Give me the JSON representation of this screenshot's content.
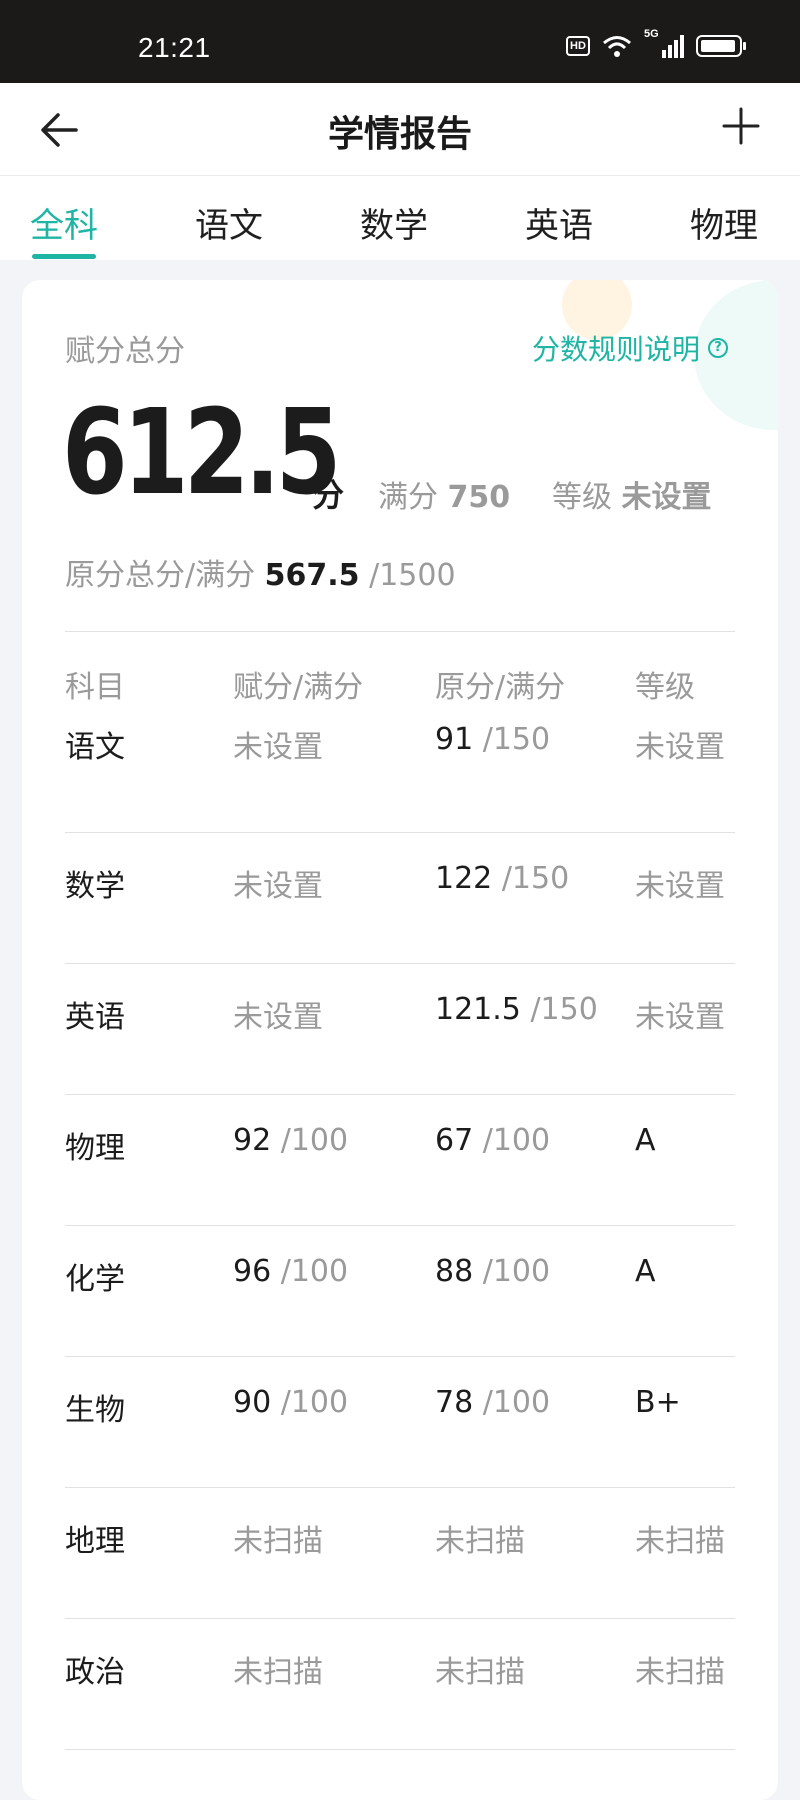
{
  "status_bar": {
    "time": "21:21",
    "hd": "HD",
    "network": "5G"
  },
  "header": {
    "title": "学情报告"
  },
  "tabs": [
    {
      "label": "全科",
      "active": true
    },
    {
      "label": "语文",
      "active": false
    },
    {
      "label": "数学",
      "active": false
    },
    {
      "label": "英语",
      "active": false
    },
    {
      "label": "物理",
      "active": false
    }
  ],
  "summary": {
    "total_label": "赋分总分",
    "rules_link": "分数规则说明",
    "score": "612.5",
    "score_unit": "分",
    "full_label": "满分",
    "full_value": "750",
    "grade_label": "等级",
    "grade_value": "未设置",
    "raw_label": "原分总分/满分",
    "raw_score": "567.5",
    "raw_full": "/1500"
  },
  "table": {
    "headers": [
      "科目",
      "赋分/满分",
      "原分/满分",
      "等级"
    ],
    "rows": [
      {
        "subject": "语文",
        "scaled": "未设置",
        "scaled_full": "",
        "raw": "91",
        "raw_full": "/150",
        "grade": "未设置"
      },
      {
        "subject": "数学",
        "scaled": "未设置",
        "scaled_full": "",
        "raw": "122",
        "raw_full": "/150",
        "grade": "未设置"
      },
      {
        "subject": "英语",
        "scaled": "未设置",
        "scaled_full": "",
        "raw": "121.5",
        "raw_full": "/150",
        "grade": "未设置"
      },
      {
        "subject": "物理",
        "scaled": "92",
        "scaled_full": "/100",
        "raw": "67",
        "raw_full": "/100",
        "grade": "A"
      },
      {
        "subject": "化学",
        "scaled": "96",
        "scaled_full": "/100",
        "raw": "88",
        "raw_full": "/100",
        "grade": "A"
      },
      {
        "subject": "生物",
        "scaled": "90",
        "scaled_full": "/100",
        "raw": "78",
        "raw_full": "/100",
        "grade": "B+"
      },
      {
        "subject": "地理",
        "scaled": "未扫描",
        "scaled_full": "",
        "raw": "未扫描",
        "raw_full": "",
        "grade": "未扫描"
      },
      {
        "subject": "政治",
        "scaled": "未扫描",
        "scaled_full": "",
        "raw": "未扫描",
        "raw_full": "",
        "grade": "未扫描"
      }
    ]
  },
  "colors": {
    "accent": "#1fb5a5",
    "muted": "#9a9a9a",
    "status_bar": "#1b1a19"
  },
  "icons": {
    "back": "arrow-left-icon",
    "add": "plus-icon",
    "help": "question-circle-icon",
    "wifi": "wifi-icon",
    "signal": "signal-icon",
    "battery": "battery-icon"
  }
}
